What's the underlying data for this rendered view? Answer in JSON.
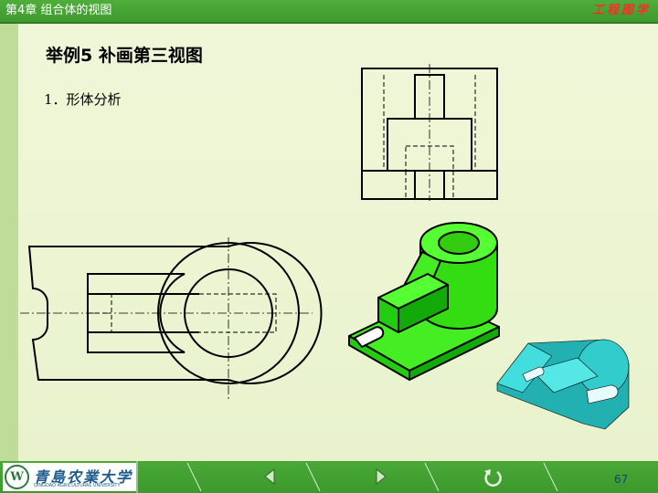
{
  "header": {
    "chapter_title": "第4章  组合体的视图",
    "course_title": "工程图学"
  },
  "slide": {
    "title": "举例5  补画第三视图",
    "section_label": "1．形体分析"
  },
  "drawings": {
    "front_view": "front-view",
    "top_view": "top-view",
    "green_model": "isometric-model-green",
    "cyan_model": "isometric-model-cyan"
  },
  "colors": {
    "header_green": "#3e9a2d",
    "background": "#eaf3cf",
    "course_title_red": "#ff2a2a",
    "model_green": "#22ee11",
    "model_cyan": "#33cccc"
  },
  "footer": {
    "logo_text": "青島农業大学",
    "logo_subtext": "QINGDAO AGRICULTURAL UNIVERSITY",
    "prev_icon": "triangle-left-icon",
    "next_icon": "triangle-right-icon",
    "return_icon": "return-icon",
    "page_number": "67"
  }
}
